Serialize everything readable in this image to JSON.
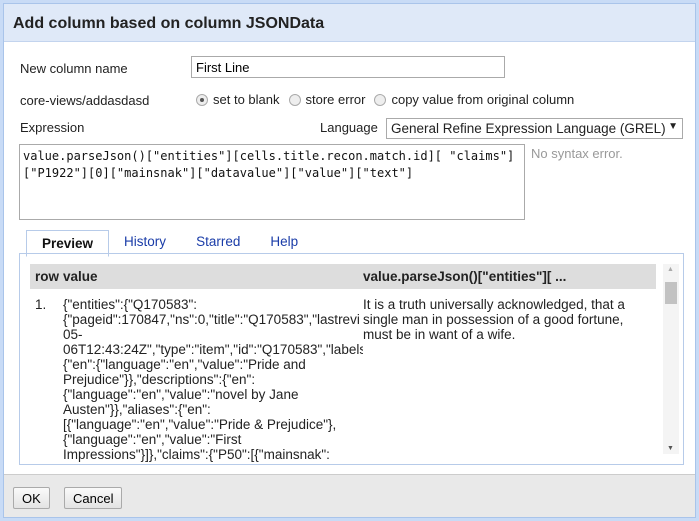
{
  "dialog": {
    "title": "Add column based on column JSONData"
  },
  "form": {
    "new_column_label": "New column name",
    "new_column_value": "First Line",
    "on_error_label": "core-views/addasdasd",
    "on_error_options": [
      {
        "label": "set to blank",
        "selected": true
      },
      {
        "label": "store error",
        "selected": false
      },
      {
        "label": "copy value from original column",
        "selected": false
      }
    ],
    "expression_label": "Expression",
    "language_label": "Language",
    "language_value": "General Refine Expression Language (GREL)",
    "expression": "value.parseJson()[\"entities\"][cells.title.recon.match.id][ \"claims\"][\"P1922\"][0][\"mainsnak\"][\"datavalue\"][\"value\"][\"text\"]",
    "syntax_status": "No syntax error."
  },
  "tabs": [
    {
      "label": "Preview",
      "active": true
    },
    {
      "label": "History"
    },
    {
      "label": "Starred"
    },
    {
      "label": "Help"
    }
  ],
  "preview": {
    "headers": [
      "row",
      "value",
      "value.parseJson()[\"entities\"][ ..."
    ],
    "rows": [
      {
        "row": "1.",
        "value_lines": [
          "{\"entities\":{\"Q170583\":",
          "{\"pageid\":170847,\"ns\":0,\"title\":\"Q170583\",\"lastrevi",
          "05-",
          "06T12:43:24Z\",\"type\":\"item\",\"id\":\"Q170583\",\"labels",
          "{\"en\":{\"language\":\"en\",\"value\":\"Pride and",
          "Prejudice\"}},\"descriptions\":{\"en\":",
          "{\"language\":\"en\",\"value\":\"novel by Jane",
          "Austen\"}},\"aliases\":{\"en\":",
          "[{\"language\":\"en\",\"value\":\"Pride & Prejudice\"},",
          "{\"language\":\"en\",\"value\":\"First",
          "Impressions\"}]},\"claims\":{\"P50\":[{\"mainsnak\":"
        ],
        "result": "It is a truth universally acknowledged, that a single man in possession of a good fortune, must be in want of a wife."
      }
    ]
  },
  "footer": {
    "ok": "OK",
    "cancel": "Cancel"
  }
}
